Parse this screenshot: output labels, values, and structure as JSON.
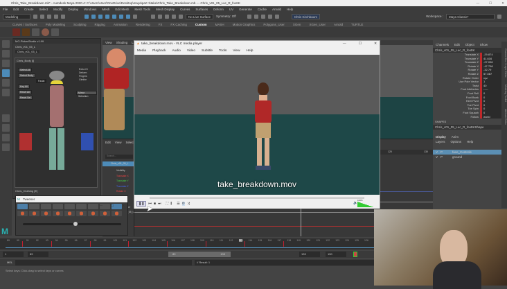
{
  "window": {
    "title": "Chris_Take_Breakdown.mb* - Autodesk Maya 2020.4: C:\\Users\\User\\OneDrive\\Desktop\\maya\\part 1\\take\\Chris_Take_Breakdown.mb  ---  Chris_v01_05_Luc_R_footIK"
  },
  "menubar": [
    "File",
    "Edit",
    "Create",
    "Select",
    "Modify",
    "Display",
    "Windows",
    "Mesh",
    "Edit Mesh",
    "Mesh Tools",
    "Mesh Display",
    "Curves",
    "Surfaces",
    "Deform",
    "UV",
    "Generate",
    "Cache",
    "Arnold",
    "Help"
  ],
  "toolbar": {
    "mode": "Modeling",
    "live_surface": "No Live Surface",
    "symmetry": "Symmetry: Off",
    "user": "Chris Kirchbaum",
    "workspace_label": "Workspace :",
    "workspace": "Maya Classic*"
  },
  "shelf_tabs": [
    "Curves / Surfaces",
    "Poly Modeling",
    "Sculpting",
    "Rigging",
    "Animation",
    "Rendering",
    "FX",
    "FX Caching",
    "Custom",
    "MASH",
    "Motion Graphics",
    "Polygons_User",
    "XGen",
    "XGen_User",
    "Arnold",
    "TURTLE"
  ],
  "shelf_active": "Custom",
  "picker": {
    "title": "MG-PickerStudio v1.99",
    "namespace": "Chris_v01_05_L",
    "tab": "Chris_Body [I]",
    "facial": "Facial",
    "buttons": [
      "Select All",
      "Select Body",
      "Key All",
      "Reset All",
      "Reset Sel",
      "Mirror Selection"
    ],
    "bottom_tab": "Chris_Clothing [E]",
    "panel_labels": [
      "Selecting",
      "Key/Reset",
      "Show/Hide",
      "Mirror"
    ],
    "checks": [
      "Extra Ct",
      "Deform",
      "Fingers",
      "Gimble"
    ]
  },
  "viewport": {
    "menu": [
      "View",
      "Shading",
      "Lighting"
    ]
  },
  "graph": {
    "menu": [
      "Edit",
      "View",
      "Select"
    ],
    "search_placeholder": "Search...",
    "node": "Chris_v01_05_L",
    "ticks": [
      "120",
      "130"
    ],
    "attr_rows": [
      "Visibility",
      "Translate X",
      "Translate Y",
      "Translate Z",
      "Rotate X",
      "Rotate Y",
      "Rotate Z",
      "Rotate Order",
      "Chris_v01_05_Luc_E_H",
      "Scale X",
      "Scale Y"
    ]
  },
  "vlc": {
    "title": "take_breakdown.mov - VLC media player",
    "menu": [
      "Media",
      "Playback",
      "Audio",
      "Video",
      "Subtitle",
      "Tools",
      "View",
      "Help"
    ],
    "subtitle": "take_breakdown.mov",
    "volume": "100%",
    "volume_level": 100,
    "progress": 0
  },
  "channel_box": {
    "menu": [
      "Channels",
      "Edit",
      "Object",
      "Show"
    ],
    "node": "Chris_v01_05_Luc_R_footIK",
    "rows": [
      {
        "n": "Translate X",
        "v": "-29.874"
      },
      {
        "n": "Translate Y",
        "v": "41.616"
      },
      {
        "n": "Translate Z",
        "v": "-27.096"
      },
      {
        "n": "Rotate X",
        "v": "-47.798"
      },
      {
        "n": "Rotate Y",
        "v": "-32.79"
      },
      {
        "n": "Rotate Z",
        "v": "57.087"
      },
      {
        "n": "Rotate Order",
        "v": "xyz"
      },
      {
        "n": "Use Pole Vector",
        "v": "1"
      },
      {
        "n": "Twist",
        "v": "40"
      },
      {
        "n": "Foot Attributes",
        "v": "-----"
      },
      {
        "n": "Foot Roll",
        "v": "0"
      },
      {
        "n": "Foot Bank",
        "v": "0"
      },
      {
        "n": "Heel Pivot",
        "v": "0"
      },
      {
        "n": "Toe Pivot",
        "v": "0"
      },
      {
        "n": "Toe Spin",
        "v": "0"
      },
      {
        "n": "Foot Squash",
        "v": "0"
      },
      {
        "n": "Follow",
        "v": "world"
      }
    ],
    "shapes_label": "SHAPES",
    "shape": "Chris_v01_05_Luc_R_footIKShape",
    "layer_tabs": [
      "Display",
      "Anim"
    ],
    "layer_menu": [
      "Layers",
      "Options",
      "Help"
    ],
    "layers": [
      {
        "v": "V",
        "p": "P",
        "name": "face_Controls"
      },
      {
        "v": "V",
        "p": "P",
        "name": "ground"
      }
    ],
    "side_tabs": [
      "Channel Box / Layer Editor",
      "Modeling Toolkit",
      "Attribute Editor"
    ]
  },
  "tweener": {
    "title": "Tweener"
  },
  "timeline": {
    "ticks": [
      "89",
      "90",
      "91",
      "92",
      "93",
      "94",
      "95",
      "96",
      "97",
      "98",
      "99",
      "100",
      "101",
      "102",
      "103",
      "104",
      "105",
      "106",
      "107",
      "108",
      "109",
      "110",
      "111",
      "112",
      "113",
      "114",
      "115",
      "116",
      "117",
      "118",
      "119",
      "120",
      "121",
      "122",
      "123",
      "124",
      "125",
      "126",
      "127"
    ],
    "current": "113"
  },
  "range": {
    "start": "1",
    "inner_start": "89",
    "slider_start": "89",
    "slider_end": "133",
    "inner_end": "133",
    "end": "150"
  },
  "mel": {
    "label": "MEL",
    "result": "// Result: 1"
  },
  "help_line": "Select keys: Click-drag to select keys or curves"
}
